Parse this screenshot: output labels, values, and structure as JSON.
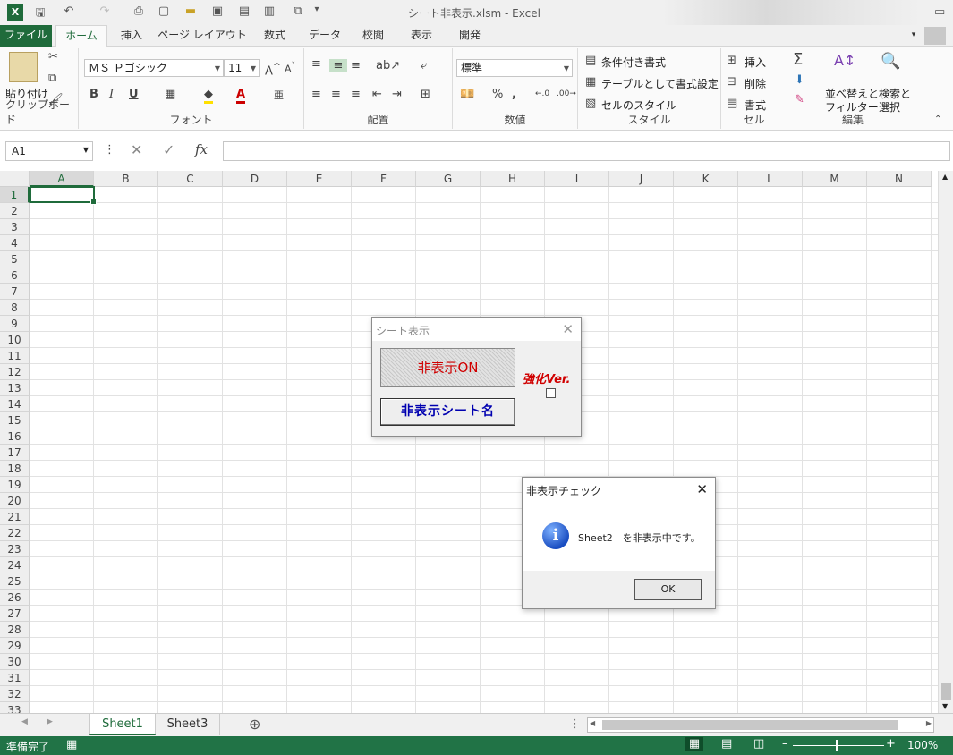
{
  "app": {
    "title": "シート非表示.xlsm - Excel"
  },
  "tabs": [
    "ファイル",
    "ホーム",
    "挿入",
    "ページ レイアウト",
    "数式",
    "データ",
    "校閲",
    "表示",
    "開発"
  ],
  "ribbon": {
    "clipboard": {
      "paste": "貼り付け",
      "label": "クリップボード"
    },
    "font": {
      "name": "ＭＳ Ｐゴシック",
      "size": "11",
      "bold": "B",
      "italic": "I",
      "underline": "U",
      "label": "フォント"
    },
    "alignment": {
      "label": "配置"
    },
    "number": {
      "format": "標準",
      "percent": "%",
      "comma": ",",
      "label": "数値"
    },
    "styles": {
      "cond": "条件付き書式",
      "table": "テーブルとして書式設定",
      "cell": "セルのスタイル",
      "label": "スタイル"
    },
    "cells": {
      "insert": "挿入",
      "delete": "削除",
      "format": "書式",
      "label": "セル"
    },
    "editing": {
      "sort_line1": "並べ替えと",
      "sort_line2": "フィルター",
      "find_line1": "検索と",
      "find_line2": "選択",
      "label": "編集"
    }
  },
  "formula_bar": {
    "name_box": "A1",
    "fx": "fx",
    "value": ""
  },
  "columns": [
    "A",
    "B",
    "C",
    "D",
    "E",
    "F",
    "G",
    "H",
    "I",
    "J",
    "K",
    "L",
    "M",
    "N"
  ],
  "rows": [
    "1",
    "2",
    "3",
    "4",
    "5",
    "6",
    "7",
    "8",
    "9",
    "10",
    "11",
    "12",
    "13",
    "14",
    "15",
    "16",
    "17",
    "18",
    "19",
    "20",
    "21",
    "22",
    "23",
    "24",
    "25",
    "26",
    "27",
    "28",
    "29",
    "30",
    "31",
    "32",
    "33"
  ],
  "sheet_tabs": [
    "Sheet1",
    "Sheet3"
  ],
  "status": {
    "ready": "準備完了",
    "zoom": "100%"
  },
  "userform": {
    "title": "シート表示",
    "hide_button": "非表示ON",
    "names_button": "非表示シート名",
    "enhanced_label": "強化Ver."
  },
  "msgbox": {
    "title": "非表示チェック",
    "message": "Sheet2　を非表示中です。",
    "ok": "OK"
  }
}
